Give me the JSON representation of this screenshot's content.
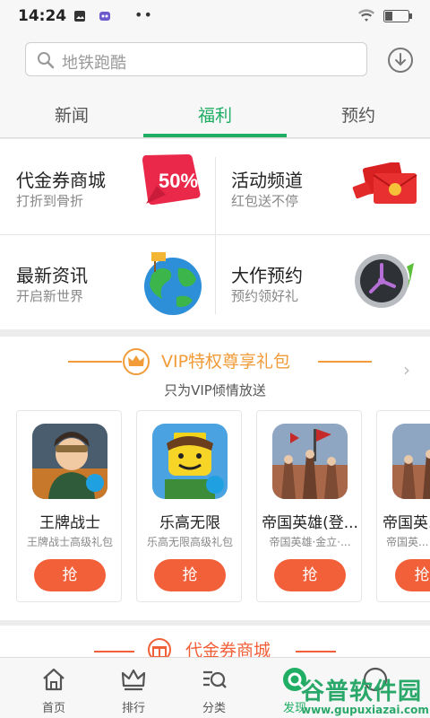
{
  "status": {
    "time": "14:24"
  },
  "search": {
    "placeholder": "地铁跑酷"
  },
  "tabs": [
    {
      "label": "新闻"
    },
    {
      "label": "福利"
    },
    {
      "label": "预约"
    }
  ],
  "grid": [
    {
      "title": "代金券商城",
      "subtitle": "打折到骨折",
      "badge": "50%"
    },
    {
      "title": "活动频道",
      "subtitle": "红包送不停"
    },
    {
      "title": "最新资讯",
      "subtitle": "开启新世界"
    },
    {
      "title": "大作预约",
      "subtitle": "预约领好礼"
    }
  ],
  "vip": {
    "title": "VIP特权尊享礼包",
    "subtitle": "只为VIP倾情放送",
    "cards": [
      {
        "name": "王牌战士",
        "desc": "王牌战士高级礼包",
        "button": "抢"
      },
      {
        "name": "乐高无限",
        "desc": "乐高无限高级礼包",
        "button": "抢"
      },
      {
        "name": "帝国英雄(登...",
        "desc": "帝国英雄·金立·...",
        "button": "抢"
      },
      {
        "name": "帝国英...",
        "desc": "帝国英...",
        "button": "抢"
      }
    ]
  },
  "section2": {
    "title": "代金券商城"
  },
  "bottom_nav": [
    {
      "label": "首页"
    },
    {
      "label": "排行"
    },
    {
      "label": "分类"
    },
    {
      "label": "发现"
    },
    {
      "label": ""
    }
  ],
  "watermark": {
    "text": "谷普软件园",
    "url": "www.gupuxiazai.com"
  },
  "colors": {
    "accent": "#1fae64",
    "vip": "#f29b39",
    "button": "#f2603a"
  }
}
